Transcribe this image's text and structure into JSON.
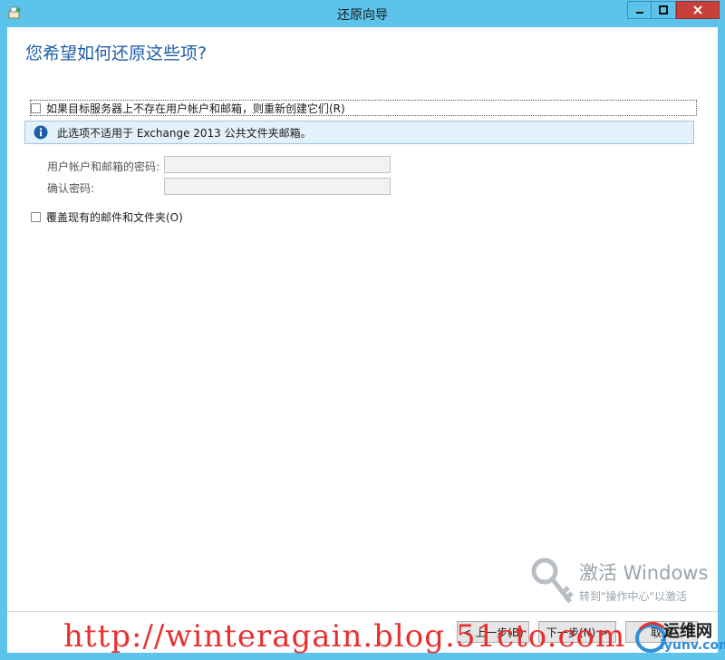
{
  "window": {
    "title": "还原向导"
  },
  "heading": "您希望如何还原这些项?",
  "options": {
    "recreate_label": "如果目标服务器上不存在用户帐户和邮箱，则重新创建它们(R)",
    "overwrite_label": "覆盖现有的邮件和文件夹(O)"
  },
  "info": {
    "message": "此选项不适用于 Exchange 2013 公共文件夹邮箱。"
  },
  "fields": {
    "password_label": "用户帐户和邮箱的密码:",
    "confirm_label": "确认密码:",
    "password_value": "",
    "confirm_value": ""
  },
  "buttons": {
    "back": "< 上一步(B)",
    "next": "下一步(N) >",
    "cancel": "取消"
  },
  "watermark": {
    "title": "激活 Windows",
    "subtitle": "转到\"操作中心\"以激活"
  },
  "overlay": {
    "url": "http://winteragain.blog.51cto.com"
  },
  "logo": {
    "line1": "运维网",
    "line2": "iyunv.com"
  },
  "colors": {
    "titlebar": "#5cc3ea",
    "close": "#c7413a",
    "heading": "#1f5ea8",
    "info_bg": "#e3f1fb",
    "url": "#e83030"
  }
}
